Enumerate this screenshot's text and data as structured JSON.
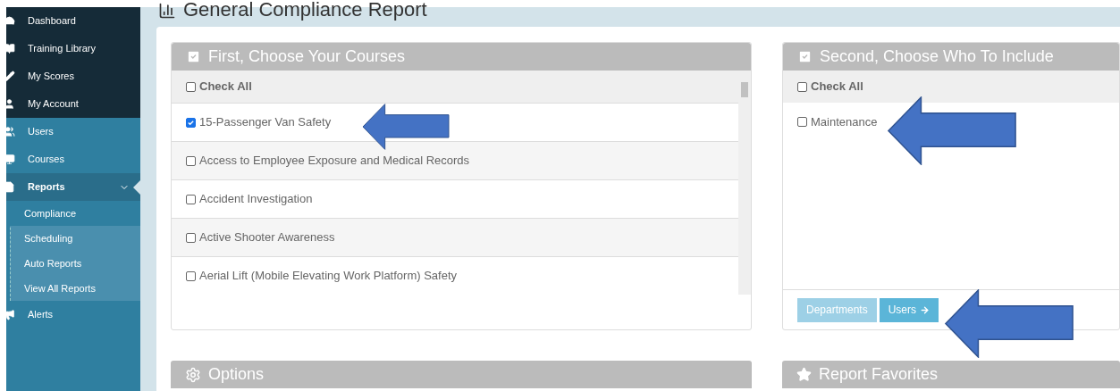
{
  "sidebar": {
    "items": [
      {
        "label": "Dashboard",
        "kind": "personal",
        "selected": false
      },
      {
        "label": "Training Library",
        "kind": "personal",
        "selected": false
      },
      {
        "label": "My Scores",
        "kind": "personal",
        "selected": false
      },
      {
        "label": "My Account",
        "kind": "personal",
        "selected": false
      },
      {
        "label": "Users",
        "kind": "admin",
        "selected": false
      },
      {
        "label": "Courses",
        "kind": "admin",
        "selected": false
      },
      {
        "label": "Reports",
        "kind": "admin",
        "selected": true,
        "expanded": true,
        "children": [
          {
            "label": "Compliance",
            "selected": true
          },
          {
            "label": "Scheduling",
            "selected": false
          },
          {
            "label": "Auto Reports",
            "selected": false
          },
          {
            "label": "View All Reports",
            "selected": false
          }
        ]
      },
      {
        "label": "Alerts",
        "kind": "admin",
        "selected": false
      }
    ]
  },
  "page_title": "General Compliance Report",
  "courses_panel": {
    "title": "First, Choose Your Courses",
    "check_all": {
      "label": "Check All",
      "checked": false
    },
    "items": [
      {
        "label": "15-Passenger Van Safety",
        "checked": true
      },
      {
        "label": "Access to Employee Exposure and Medical Records",
        "checked": false
      },
      {
        "label": "Accident Investigation",
        "checked": false
      },
      {
        "label": "Active Shooter Awareness",
        "checked": false
      },
      {
        "label": "Aerial Lift (Mobile Elevating Work Platform) Safety",
        "checked": false
      }
    ]
  },
  "include_panel": {
    "title": "Second, Choose Who To Include",
    "check_all": {
      "label": "Check All",
      "checked": false
    },
    "items": [
      {
        "label": "Maintenance",
        "checked": false
      }
    ],
    "buttons": [
      {
        "label": "Departments",
        "selected": false
      },
      {
        "label": "Users",
        "selected": true
      }
    ]
  },
  "options_panel": {
    "title": "Options"
  },
  "favorites_panel": {
    "title": "Report Favorites"
  }
}
